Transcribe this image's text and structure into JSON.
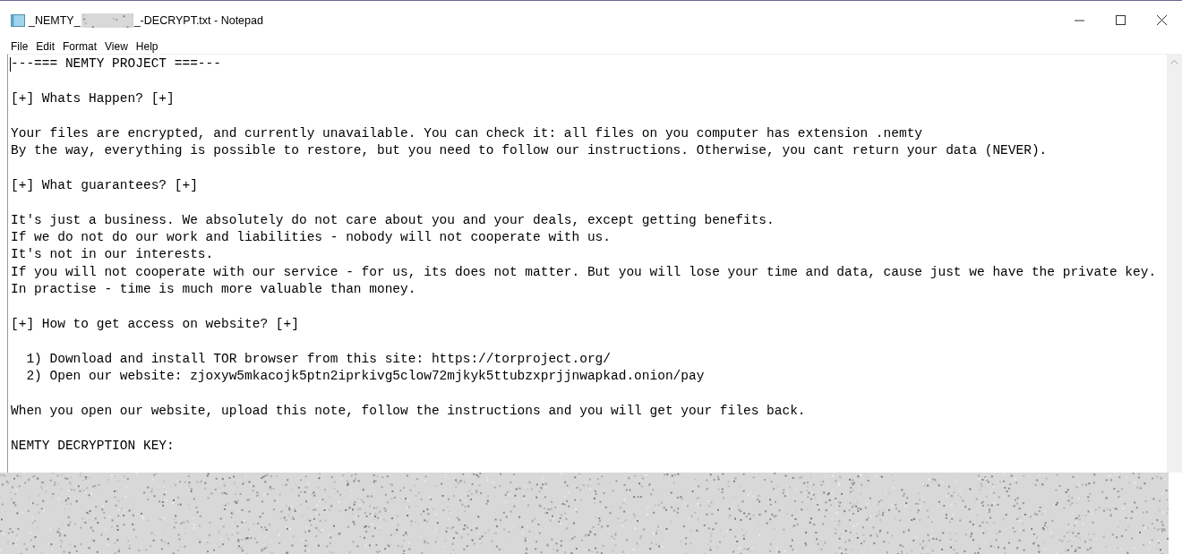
{
  "window": {
    "title_start": "_NEMTY_",
    "title_end": "_-DECRYPT.txt - Notepad"
  },
  "menu": [
    "File",
    "Edit",
    "Format",
    "View",
    "Help"
  ],
  "document": {
    "paragraphs": [
      [
        "---=== NEMTY PROJECT ===---"
      ],
      [
        "[+] Whats Happen? [+]"
      ],
      [
        "Your files are encrypted, and currently unavailable. You can check it: all files on you computer has extension .nemty",
        "By the way, everything is possible to restore, but you need to follow our instructions. Otherwise, you cant return your data (NEVER)."
      ],
      [
        "[+] What guarantees? [+]"
      ],
      [
        "It's just a business. We absolutely do not care about you and your deals, except getting benefits.",
        "If we do not do our work and liabilities - nobody will not cooperate with us.",
        "It's not in our interests.",
        "If you will not cooperate with our service - for us, its does not matter. But you will lose your time and data, cause just we have the private key.",
        "In practise - time is much more valuable than money."
      ],
      [
        "[+] How to get access on website? [+]"
      ],
      [
        "  1) Download and install TOR browser from this site: https://torproject.org/",
        "  2) Open our website: zjoxyw5mkacojk5ptn2iprkivg5clow72mjkyk5ttubzxprjjnwapkad.onion/pay"
      ],
      [
        "When you open our website, upload this note, follow the instructions and you will get your files back."
      ],
      [
        "NEMTY DECRYPTION KEY:"
      ]
    ]
  }
}
